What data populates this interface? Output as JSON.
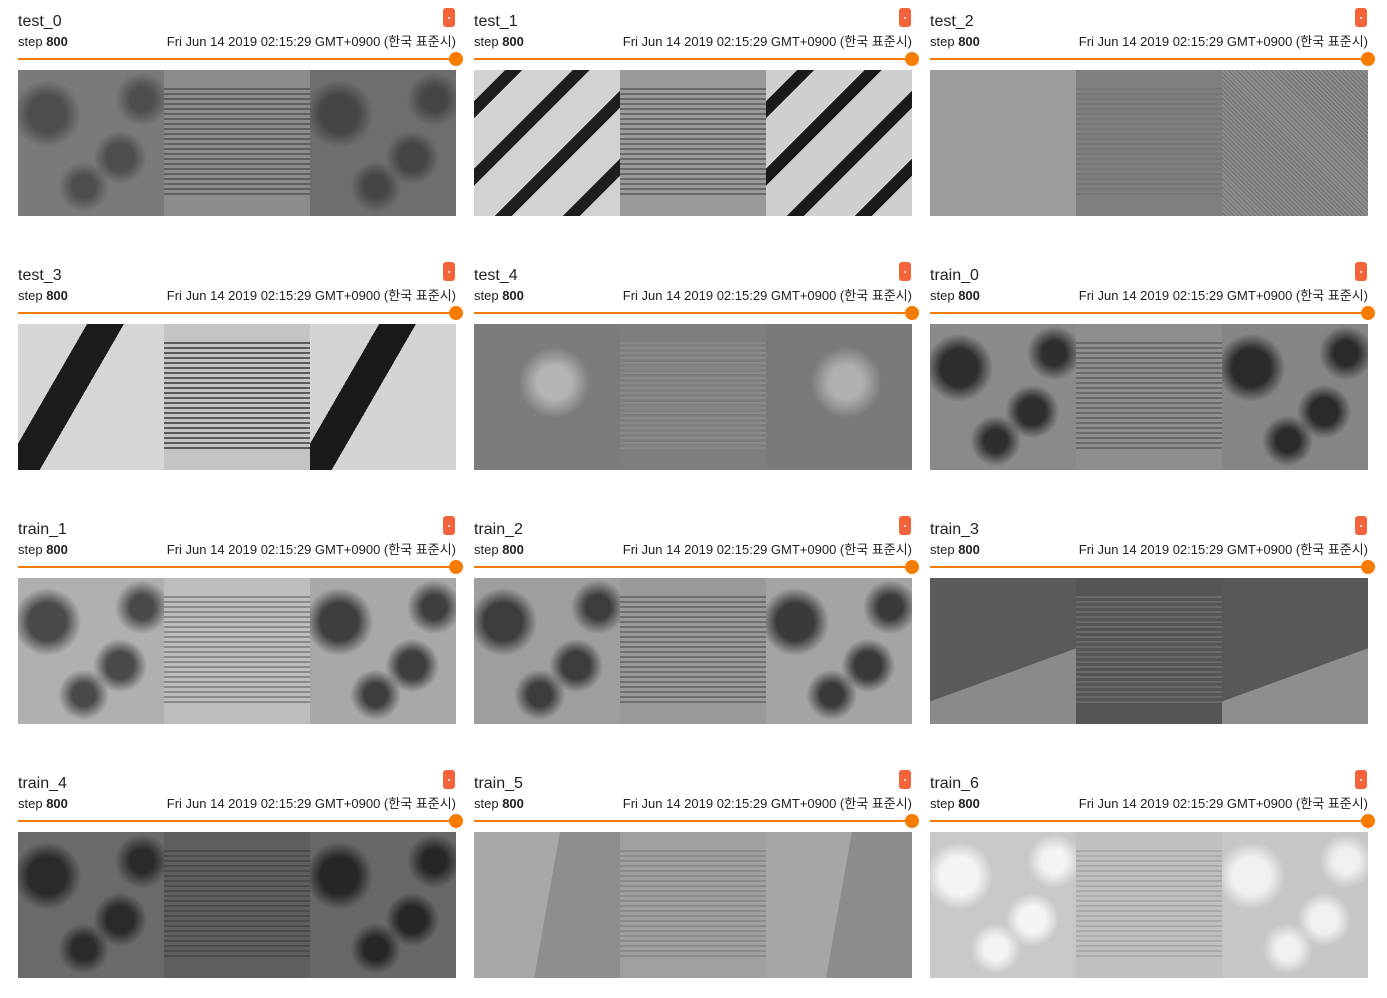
{
  "cards": [
    {
      "title": "test_0",
      "step_label": "step",
      "step_value": "800",
      "timestamp": "Fri Jun 14 2019 02:15:29 GMT+0900 (한국 표준시)",
      "slider_fraction": 1.0,
      "panels": [
        {
          "base": "#7a7a7a",
          "accent": "#4e4e4e",
          "style": "mottled"
        },
        {
          "base": "#8c8c8c",
          "accent": "#5f5f5f",
          "style": "blurred-square"
        },
        {
          "base": "#6e6e6e",
          "accent": "#454545",
          "style": "mottled"
        }
      ]
    },
    {
      "title": "test_1",
      "step_label": "step",
      "step_value": "800",
      "timestamp": "Fri Jun 14 2019 02:15:29 GMT+0900 (한국 표준시)",
      "slider_fraction": 1.0,
      "panels": [
        {
          "base": "#d2d2d2",
          "accent": "#1e1e1e",
          "style": "diagonal-stripes"
        },
        {
          "base": "#9a9a9a",
          "accent": "#6a6a6a",
          "style": "blurred-square"
        },
        {
          "base": "#cfcfcf",
          "accent": "#1a1a1a",
          "style": "diagonal-stripes"
        }
      ]
    },
    {
      "title": "test_2",
      "step_label": "step",
      "step_value": "800",
      "timestamp": "Fri Jun 14 2019 02:15:29 GMT+0900 (한국 표준시)",
      "slider_fraction": 1.0,
      "panels": [
        {
          "base": "#9c9c9c",
          "accent": "#8c8c8c",
          "style": "smooth"
        },
        {
          "base": "#7f7f7f",
          "accent": "#777777",
          "style": "blurred-square"
        },
        {
          "base": "#8e8e8e",
          "accent": "#6e6e6e",
          "style": "speckle"
        }
      ]
    },
    {
      "title": "test_3",
      "step_label": "step",
      "step_value": "800",
      "timestamp": "Fri Jun 14 2019 02:15:29 GMT+0900 (한국 표준시)",
      "slider_fraction": 1.0,
      "panels": [
        {
          "base": "#d6d6d6",
          "accent": "#1c1c1c",
          "style": "single-diagonal"
        },
        {
          "base": "#c4c4c4",
          "accent": "#5a5a5a",
          "style": "blurred-square"
        },
        {
          "base": "#d4d4d4",
          "accent": "#1a1a1a",
          "style": "single-diagonal"
        }
      ]
    },
    {
      "title": "test_4",
      "step_label": "step",
      "step_value": "800",
      "timestamp": "Fri Jun 14 2019 02:15:29 GMT+0900 (한국 표준시)",
      "slider_fraction": 1.0,
      "panels": [
        {
          "base": "#7c7c7c",
          "accent": "#b4b4b4",
          "style": "soft-blob"
        },
        {
          "base": "#7e7e7e",
          "accent": "#8a8a8a",
          "style": "blurred-square"
        },
        {
          "base": "#7a7a7a",
          "accent": "#b0b0b0",
          "style": "soft-blob"
        }
      ]
    },
    {
      "title": "train_0",
      "step_label": "step",
      "step_value": "800",
      "timestamp": "Fri Jun 14 2019 02:15:29 GMT+0900 (한국 표준시)",
      "slider_fraction": 1.0,
      "panels": [
        {
          "base": "#8a8a8a",
          "accent": "#2e2e2e",
          "style": "mottled"
        },
        {
          "base": "#8e8e8e",
          "accent": "#6a6a6a",
          "style": "blurred-square"
        },
        {
          "base": "#858585",
          "accent": "#2a2a2a",
          "style": "mottled"
        }
      ]
    },
    {
      "title": "train_1",
      "step_label": "step",
      "step_value": "800",
      "timestamp": "Fri Jun 14 2019 02:15:29 GMT+0900 (한국 표준시)",
      "slider_fraction": 1.0,
      "panels": [
        {
          "base": "#b0b0b0",
          "accent": "#4a4a4a",
          "style": "mottled"
        },
        {
          "base": "#bdbdbd",
          "accent": "#8a8a8a",
          "style": "blurred-square"
        },
        {
          "base": "#a8a8a8",
          "accent": "#3e3e3e",
          "style": "mottled"
        }
      ]
    },
    {
      "title": "train_2",
      "step_label": "step",
      "step_value": "800",
      "timestamp": "Fri Jun 14 2019 02:15:29 GMT+0900 (한국 표준시)",
      "slider_fraction": 1.0,
      "panels": [
        {
          "base": "#9e9e9e",
          "accent": "#3c3c3c",
          "style": "mottled"
        },
        {
          "base": "#999999",
          "accent": "#6e6e6e",
          "style": "blurred-square"
        },
        {
          "base": "#a4a4a4",
          "accent": "#3a3a3a",
          "style": "mottled"
        }
      ]
    },
    {
      "title": "train_3",
      "step_label": "step",
      "step_value": "800",
      "timestamp": "Fri Jun 14 2019 02:15:29 GMT+0900 (한국 표준시)",
      "slider_fraction": 1.0,
      "panels": [
        {
          "base": "#5a5a5a",
          "accent": "#8a8a8a",
          "style": "lower-band"
        },
        {
          "base": "#555555",
          "accent": "#6a6a6a",
          "style": "blurred-square"
        },
        {
          "base": "#585858",
          "accent": "#8e8e8e",
          "style": "lower-band"
        }
      ]
    },
    {
      "title": "train_4",
      "step_label": "step",
      "step_value": "800",
      "timestamp": "Fri Jun 14 2019 02:15:29 GMT+0900 (한국 표준시)",
      "slider_fraction": 1.0,
      "panels": [
        {
          "base": "#6a6a6a",
          "accent": "#2a2a2a",
          "style": "mottled"
        },
        {
          "base": "#5e5e5e",
          "accent": "#4a4a4a",
          "style": "blurred-square"
        },
        {
          "base": "#686868",
          "accent": "#262626",
          "style": "mottled"
        }
      ]
    },
    {
      "title": "train_5",
      "step_label": "step",
      "step_value": "800",
      "timestamp": "Fri Jun 14 2019 02:15:29 GMT+0900 (한국 표준시)",
      "slider_fraction": 1.0,
      "panels": [
        {
          "base": "#a8a8a8",
          "accent": "#8e8e8e",
          "style": "wedge"
        },
        {
          "base": "#a0a0a0",
          "accent": "#8a8a8a",
          "style": "blurred-square"
        },
        {
          "base": "#a6a6a6",
          "accent": "#8c8c8c",
          "style": "wedge"
        }
      ]
    },
    {
      "title": "train_6",
      "step_label": "step",
      "step_value": "800",
      "timestamp": "Fri Jun 14 2019 02:15:29 GMT+0900 (한국 표준시)",
      "slider_fraction": 1.0,
      "panels": [
        {
          "base": "#c8c8c8",
          "accent": "#f4f4f4",
          "style": "mottled"
        },
        {
          "base": "#c0c0c0",
          "accent": "#aaaaaa",
          "style": "blurred-square"
        },
        {
          "base": "#c6c6c6",
          "accent": "#f0f0f0",
          "style": "mottled"
        }
      ]
    }
  ],
  "colors": {
    "accent": "#f57c00",
    "menu_icon": "#f4633a",
    "text": "#212121"
  },
  "icons": {
    "card_menu": "card-menu-icon"
  }
}
